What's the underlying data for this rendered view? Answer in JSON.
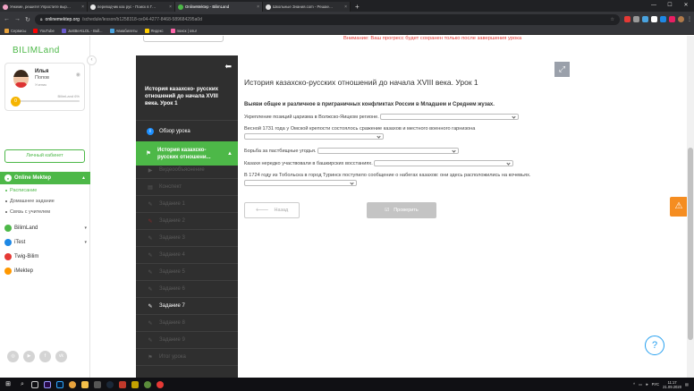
{
  "browser": {
    "tabs": [
      {
        "title": "Ункеме, решите! Упростите выр…",
        "color": "#f3a3c5",
        "active": false
      },
      {
        "title": "переводчик каз рус - Поиск в Г…",
        "color": "#e8e8e8",
        "active": false
      },
      {
        "title": "OnlineMektep - BilimLand",
        "color": "#4db848",
        "active": true
      },
      {
        "title": "Школьные Знания.com - Решае…",
        "color": "#e0e0e0",
        "active": false
      }
    ],
    "new_tab": "+",
    "window_controls": [
      "—",
      "☐",
      "✕"
    ],
    "url_domain": "onlinemektep.org",
    "url_path": "/schedule/lesson/b1258318-ce04-4277-8468-589684295a0d",
    "bookmarks": [
      {
        "label": "Сервисы",
        "color": "#e8a33d"
      },
      {
        "label": "YouTube",
        "color": "#ff0000"
      },
      {
        "label": "JustBeAtLOL - Bull...",
        "color": "#6a5acd"
      },
      {
        "label": "Авиабилеты",
        "color": "#4aa3df"
      },
      {
        "label": "Яндекс",
        "color": "#ffcc00"
      },
      {
        "label": "поиск | osu!",
        "color": "#ff66aa"
      }
    ]
  },
  "sidebar": {
    "logo": "BILIMLand",
    "profile": {
      "first_name": "Илья",
      "last_name": "Попов",
      "role": "Ученик",
      "level_label": "BilimLand 6%",
      "progress": 0.06,
      "coin": "0"
    },
    "cabinet_button": "Личный кабинет",
    "section_title": "Online Mektep",
    "sub_items": [
      {
        "label": "Расписание",
        "active": true
      },
      {
        "label": "Домашнее задание",
        "active": false
      },
      {
        "label": "Связь с учителем",
        "active": false
      }
    ],
    "products": [
      {
        "label": "BilimLand",
        "color": "#4db848",
        "chevron": true
      },
      {
        "label": "iTest",
        "color": "#1e88e5",
        "chevron": true
      },
      {
        "label": "Twig-Bilim",
        "color": "#e53935",
        "chevron": false
      },
      {
        "label": "iMektep",
        "color": "#ff9800",
        "chevron": false
      }
    ],
    "social": [
      "ig",
      "yt",
      "f",
      "vk"
    ]
  },
  "lesson_nav": {
    "title": "История казахско- русских отношений до начала XVIII века. Урок 1",
    "overview": "Обзор урока",
    "current": "История казахско-русских отношени...",
    "items": [
      {
        "label": "Видеообъяснение",
        "icon": "▶",
        "state": "dim"
      },
      {
        "label": "Конспект",
        "icon": "▤",
        "state": "dim"
      },
      {
        "label": "Задание 1",
        "icon": "✎",
        "state": "dim"
      },
      {
        "label": "Задание 2",
        "icon": "✎",
        "state": "dim-red"
      },
      {
        "label": "Задание 3",
        "icon": "✎",
        "state": "dim"
      },
      {
        "label": "Задание 4",
        "icon": "✎",
        "state": "dim"
      },
      {
        "label": "Задание 5",
        "icon": "✎",
        "state": "dim"
      },
      {
        "label": "Задание 6",
        "icon": "✎",
        "state": "dim"
      },
      {
        "label": "Задание 7",
        "icon": "✎",
        "state": "active"
      },
      {
        "label": "Задание 8",
        "icon": "✎",
        "state": "dim"
      },
      {
        "label": "Задание 9",
        "icon": "✎",
        "state": "dim"
      },
      {
        "label": "Итог урока",
        "icon": "⚑",
        "state": "dim"
      }
    ]
  },
  "content": {
    "warning": "Внимание: Ваш прогресс будет сохранен только после завершения урока",
    "lesson_title": "История казахско-русских отношений до начала XVIII века. Урок 1",
    "task": "Выяви общее и различное в приграничных конфликтах России в Младшем и Среднем жузах.",
    "q1": "Укрепление позиций царизма в Волжско-Яицком регионе.",
    "q2": "Весной 1731 года у Омской крепости состоялось сражение казахов и местного военного гарнизона",
    "q3": "Борьба за пастбищные угодья.",
    "q4": "Казахи нередко участвовали в башкирских восстаниях.",
    "q5": "В 1724 году из Тобольска в город Туринск поступило сообщение о набегах казахов: они здесь расположились на кочевьях.",
    "back_button": "Назад",
    "check_button": "Проверить"
  },
  "taskbar": {
    "lang": "РУС",
    "time": "11:17",
    "date": "21.09.2020"
  }
}
